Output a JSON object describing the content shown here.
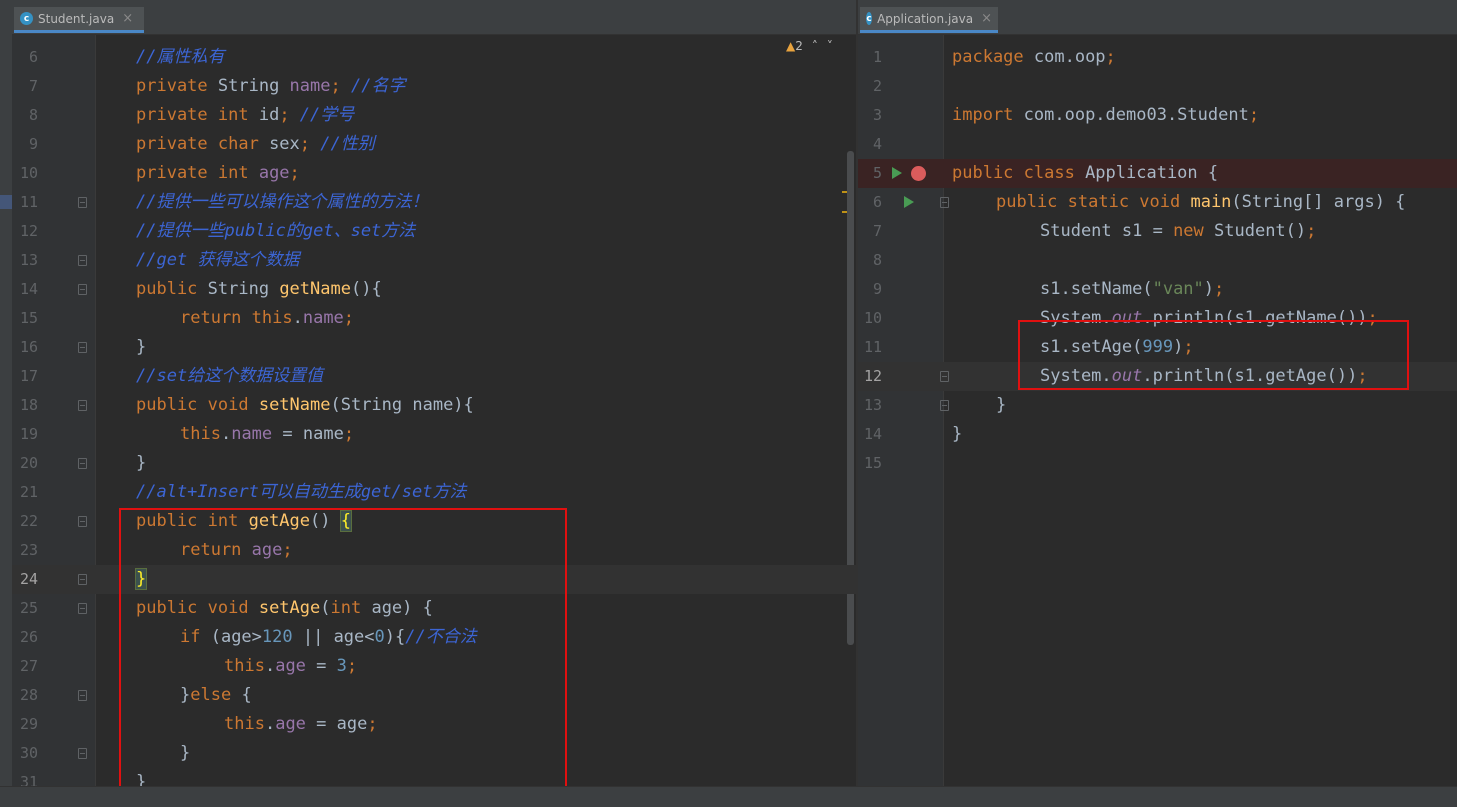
{
  "left_editor": {
    "tab": {
      "title": "Student.java",
      "icon": "c-class-icon",
      "close": "×"
    },
    "inspections": {
      "warnings": "2",
      "up": "˄",
      "down": "˅"
    },
    "lines": [
      {
        "n": "6"
      },
      {
        "n": "7"
      },
      {
        "n": "8"
      },
      {
        "n": "9"
      },
      {
        "n": "10"
      },
      {
        "n": "11"
      },
      {
        "n": "12"
      },
      {
        "n": "13"
      },
      {
        "n": "14"
      },
      {
        "n": "15"
      },
      {
        "n": "16"
      },
      {
        "n": "17"
      },
      {
        "n": "18"
      },
      {
        "n": "19"
      },
      {
        "n": "20"
      },
      {
        "n": "21"
      },
      {
        "n": "22"
      },
      {
        "n": "23"
      },
      {
        "n": "24"
      },
      {
        "n": "25"
      },
      {
        "n": "26"
      },
      {
        "n": "27"
      },
      {
        "n": "28"
      },
      {
        "n": "29"
      },
      {
        "n": "30"
      },
      {
        "n": "31"
      }
    ],
    "code": {
      "l6": {
        "c": "//属性私有"
      },
      "l7": {
        "k": "private ",
        "t": "String ",
        "f": "name",
        "p": "; ",
        "c": "//名字"
      },
      "l8": {
        "k": "private int ",
        "t": "id",
        "p": "; ",
        "c": "//学号"
      },
      "l9": {
        "k": "private char ",
        "t": "sex",
        "p": "; ",
        "c": "//性别"
      },
      "l10": {
        "k": "private int ",
        "f": "age",
        "p": ";"
      },
      "l11": {
        "c": "//提供一些可以操作这个属性的方法！"
      },
      "l12": {
        "c": "//提供一些public的get、set方法"
      },
      "l13": {
        "c": "//get 获得这个数据"
      },
      "l14": {
        "k": "public ",
        "t": "String ",
        "fn": "getName",
        "p": "(){"
      },
      "l15": {
        "k": "return this",
        "p1": ".",
        "f": "name",
        "p": ";"
      },
      "l16": {
        "p": "}"
      },
      "l17": {
        "c": "//set给这个数据设置值"
      },
      "l18": {
        "k": "public void ",
        "fn": "setName",
        "p1": "(String name){"
      },
      "l19": {
        "k": "this",
        "p1": ".",
        "f": "name",
        "p2": " = name",
        "p": ";"
      },
      "l20": {
        "p": "}"
      },
      "l21": {
        "c": "//alt+Insert可以自动生成get/set方法"
      },
      "l22": {
        "k": "public int ",
        "fn": "getAge",
        "p1": "() ",
        "b": "{"
      },
      "l23": {
        "k": "return ",
        "f": "age",
        "p": ";"
      },
      "l24": {
        "b": "}"
      },
      "l25": {
        "k": "public void ",
        "fn": "setAge",
        "p1": "(",
        "k2": "int ",
        "p2": "age) {"
      },
      "l26": {
        "k": "if ",
        "p1": "(age>",
        "n1": "120",
        "p2": " || age<",
        "n2": "0",
        "p3": "){",
        "c": "//不合法"
      },
      "l27": {
        "k": "this",
        "p1": ".",
        "f": "age",
        "p2": " = ",
        "n1": "3",
        "p": ";"
      },
      "l28": {
        "p1": "}",
        "k": "else ",
        "p2": "{"
      },
      "l29": {
        "k": "this",
        "p1": ".",
        "f": "age",
        "p2": " = age",
        "p": ";"
      },
      "l30": {
        "p": "}"
      },
      "l31": {
        "p": "}"
      }
    }
  },
  "right_editor": {
    "tab": {
      "title": "Application.java",
      "icon": "c-class-icon",
      "close": "×"
    },
    "lines": [
      {
        "n": "1"
      },
      {
        "n": "2"
      },
      {
        "n": "3"
      },
      {
        "n": "4"
      },
      {
        "n": "5"
      },
      {
        "n": "6"
      },
      {
        "n": "7"
      },
      {
        "n": "8"
      },
      {
        "n": "9"
      },
      {
        "n": "10"
      },
      {
        "n": "11"
      },
      {
        "n": "12"
      },
      {
        "n": "13"
      },
      {
        "n": "14"
      },
      {
        "n": "15"
      }
    ],
    "code": {
      "l1": {
        "k": "package ",
        "p": "com.oop",
        "k2": ";"
      },
      "l3": {
        "k": "import ",
        "p": "com.oop.demo03.Student",
        "k2": ";"
      },
      "l5": {
        "k": "public class ",
        "p": "Application {"
      },
      "l6": {
        "k": "public static void ",
        "fn": "main",
        "p": "(String[] args) {"
      },
      "l7": {
        "p1": "Student s1 = ",
        "k": "new ",
        "p2": "Student()",
        "k2": ";"
      },
      "l9": {
        "p1": "s1.setName(",
        "s": "\"van\"",
        "p2": ")",
        "k2": ";"
      },
      "l10": {
        "p1": "System.",
        "st": "out",
        "p2": ".println(s1.getName())",
        "k2": ";"
      },
      "l11": {
        "p1": "s1.setAge(",
        "n": "999",
        "p2": ")",
        "k2": ";"
      },
      "l12": {
        "p1": "System.",
        "st": "out",
        "p2": ".println(s1.getAge())",
        "k2": ";"
      },
      "l13": {
        "p": "}"
      },
      "l14": {
        "p": "}"
      }
    }
  },
  "colors": {
    "annotation_box": "#e01010",
    "breakpoint": "#db5c5c",
    "run_icon": "#499c54"
  }
}
